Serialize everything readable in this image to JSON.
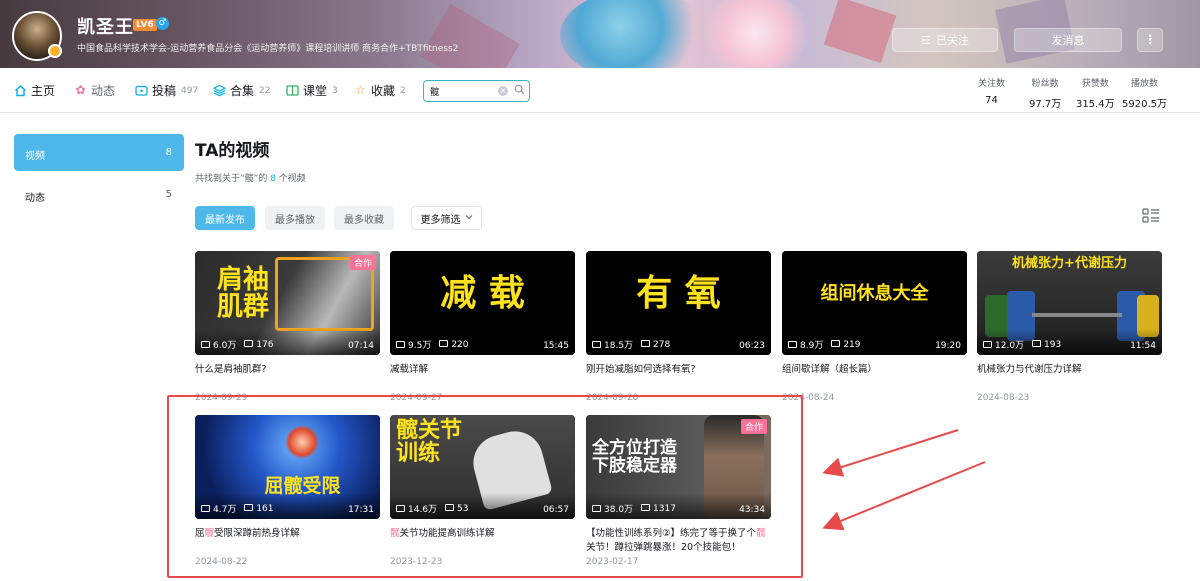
{
  "header": {
    "username": "凯圣王",
    "level": "LV6",
    "gender_icon": "male-icon",
    "sign": "中国食品科学技术学会-运动营养食品分会《运动营养师》课程培训讲师 商务合作+TBTfitness2",
    "follow_button": "已关注",
    "message_button": "发消息",
    "more_icon": "more-vertical-icon"
  },
  "nav": {
    "home": "主页",
    "dynamic": "动态",
    "posts": {
      "label": "投稿",
      "count": "497"
    },
    "collections": {
      "label": "合集",
      "count": "22"
    },
    "course": {
      "label": "课堂",
      "count": "3"
    },
    "favorites": {
      "label": "收藏",
      "count": "2"
    },
    "search_value": "髋"
  },
  "stats": [
    {
      "label": "关注数",
      "value": "74"
    },
    {
      "label": "粉丝数",
      "value": "97.7万"
    },
    {
      "label": "获赞数",
      "value": "315.4万"
    },
    {
      "label": "播放数",
      "value": "5920.5万"
    }
  ],
  "sidebar": {
    "items": [
      {
        "label": "视频",
        "count": "8"
      },
      {
        "label": "动态",
        "count": "5"
      }
    ]
  },
  "main": {
    "title": "TA的视频",
    "found_prefix": "共找到关于“髋”的 ",
    "found_count": "8",
    "found_suffix": " 个视频",
    "filters": [
      "最新发布",
      "最多播放",
      "最多收藏",
      "更多筛选"
    ]
  },
  "videos": [
    {
      "caption": "肩袖\n肌群",
      "badge": "合作",
      "plays": "6.0万",
      "comments": "176",
      "duration": "07:14",
      "title_pre": "什么是肩袖肌群?",
      "title_hl": "",
      "title_post": "",
      "date": "2024-09-29"
    },
    {
      "caption": "减 载",
      "badge": "",
      "plays": "9.5万",
      "comments": "220",
      "duration": "15:45",
      "title_pre": "减载详解",
      "title_hl": "",
      "title_post": "",
      "date": "2024-09-27"
    },
    {
      "caption": "有 氧",
      "badge": "",
      "plays": "18.5万",
      "comments": "278",
      "duration": "06:23",
      "title_pre": "刚开始减脂如何选择有氧?",
      "title_hl": "",
      "title_post": "",
      "date": "2024-09-20"
    },
    {
      "caption": "组间休息大全",
      "badge": "",
      "plays": "8.9万",
      "comments": "219",
      "duration": "19:20",
      "title_pre": "组间歇详解（超长篇）",
      "title_hl": "",
      "title_post": "",
      "date": "2024-08-24"
    },
    {
      "caption": "机械张力+代谢压力",
      "badge": "",
      "plays": "12.0万",
      "comments": "193",
      "duration": "11:54",
      "title_pre": "机械张力与代谢压力详解",
      "title_hl": "",
      "title_post": "",
      "date": "2024-08-23"
    },
    {
      "caption": "屈髋受限",
      "badge": "",
      "plays": "4.7万",
      "comments": "161",
      "duration": "17:31",
      "title_pre": "屈",
      "title_hl": "髋",
      "title_post": "受限深蹲前热身详解",
      "date": "2024-08-22"
    },
    {
      "caption": "髋关节\n训练",
      "badge": "",
      "plays": "14.6万",
      "comments": "53",
      "duration": "06:57",
      "title_pre": "",
      "title_hl": "髋",
      "title_post": "关节功能提高训练详解",
      "date": "2023-12-23"
    },
    {
      "caption": "全方位打造\n下肢稳定器",
      "badge": "合作",
      "plays": "38.0万",
      "comments": "1317",
      "duration": "43:34",
      "title_pre": "【功能性训练系列②】练完了等于换了个",
      "title_hl": "髋",
      "title_post": "关节！蹲拉弹跳暴涨！20个技能包！",
      "date": "2023-02-17"
    }
  ],
  "colors": {
    "accent": "#4fb8eb",
    "highlight": "#fb7299",
    "annotation": "#e64a4a"
  }
}
